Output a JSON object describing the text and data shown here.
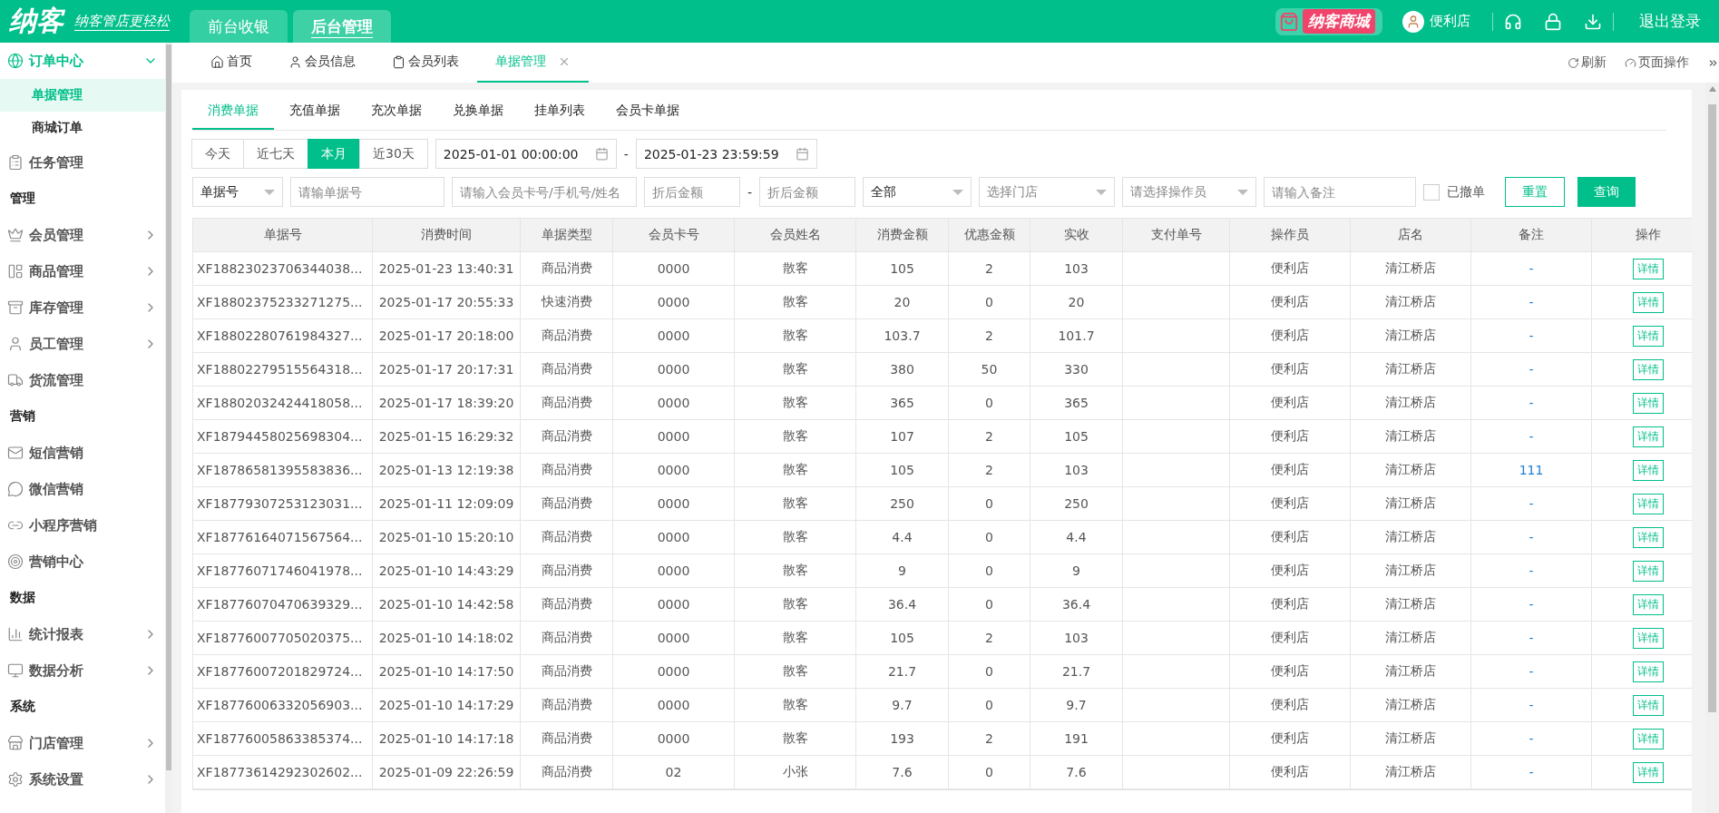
{
  "header": {
    "logo": "纳客",
    "slogan": "纳客管店更轻松",
    "nav": [
      {
        "label": "前台收银",
        "selected": false
      },
      {
        "label": "后台管理",
        "selected": true
      }
    ],
    "mall": "纳客商城",
    "user": "便利店",
    "logout": "退出登录"
  },
  "sidebar": {
    "items": [
      {
        "kind": "menu",
        "label": "订单中心",
        "expanded": true,
        "children": [
          {
            "label": "单据管理",
            "selected": true
          },
          {
            "label": "商城订单",
            "selected": false
          }
        ]
      },
      {
        "kind": "link",
        "label": "任务管理"
      },
      {
        "kind": "section",
        "label": "管理"
      },
      {
        "kind": "menu",
        "label": "会员管理",
        "expanded": false
      },
      {
        "kind": "menu",
        "label": "商品管理",
        "expanded": false
      },
      {
        "kind": "menu",
        "label": "库存管理",
        "expanded": false
      },
      {
        "kind": "menu",
        "label": "员工管理",
        "expanded": false
      },
      {
        "kind": "link",
        "label": "货流管理"
      },
      {
        "kind": "section",
        "label": "营销"
      },
      {
        "kind": "link",
        "label": "短信营销"
      },
      {
        "kind": "link",
        "label": "微信营销"
      },
      {
        "kind": "link",
        "label": "小程序营销"
      },
      {
        "kind": "link",
        "label": "营销中心"
      },
      {
        "kind": "section",
        "label": "数据"
      },
      {
        "kind": "menu",
        "label": "统计报表",
        "expanded": false
      },
      {
        "kind": "menu",
        "label": "数据分析",
        "expanded": false
      },
      {
        "kind": "section",
        "label": "系统"
      },
      {
        "kind": "menu",
        "label": "门店管理",
        "expanded": false
      },
      {
        "kind": "menu",
        "label": "系统设置",
        "expanded": false
      }
    ]
  },
  "page_tabs": [
    {
      "label": "首页",
      "selected": false,
      "closable": false
    },
    {
      "label": "会员信息",
      "selected": false,
      "closable": false
    },
    {
      "label": "会员列表",
      "selected": false,
      "closable": false
    },
    {
      "label": "单据管理",
      "selected": true,
      "closable": true
    }
  ],
  "page_actions": [
    "刷新",
    "页面操作"
  ],
  "sub_tabs": [
    {
      "label": "消费单据",
      "selected": true
    },
    {
      "label": "充值单据",
      "selected": false
    },
    {
      "label": "充次单据",
      "selected": false
    },
    {
      "label": "兑换单据",
      "selected": false
    },
    {
      "label": "挂单列表",
      "selected": false
    },
    {
      "label": "会员卡单据",
      "selected": false
    }
  ],
  "date_ranges": [
    {
      "label": "今天",
      "selected": false
    },
    {
      "label": "近七天",
      "selected": false
    },
    {
      "label": "本月",
      "selected": true
    },
    {
      "label": "近30天",
      "selected": false
    }
  ],
  "date_from": "2025-01-01 00:00:00",
  "date_separator": "-",
  "date_to": "2025-01-23 23:59:59",
  "filters": [
    {
      "kind": "select",
      "value": "单据号"
    },
    {
      "kind": "input",
      "placeholder": "请输单据号"
    },
    {
      "kind": "input",
      "placeholder": "请输入会员卡号/手机号/姓名"
    },
    {
      "kind": "input",
      "placeholder": "折后金额"
    },
    {
      "kind": "dash",
      "text": "-"
    },
    {
      "kind": "input",
      "placeholder": "折后金额"
    },
    {
      "kind": "select",
      "value": "全部"
    },
    {
      "kind": "select",
      "placeholder": "选择门店"
    },
    {
      "kind": "select",
      "placeholder": "请选择操作员"
    },
    {
      "kind": "input",
      "placeholder": "请输入备注"
    }
  ],
  "revoked": {
    "label": "已撤单",
    "checked": false
  },
  "buttons": {
    "reset": "重置",
    "query": "查询"
  },
  "table": {
    "columns": [
      "单据号",
      "消费时间",
      "单据类型",
      "会员卡号",
      "会员姓名",
      "消费金额",
      "优惠金额",
      "实收",
      "支付单号",
      "操作员",
      "店名",
      "备注",
      "操作"
    ],
    "rows": [
      [
        "XF18823023706344038...",
        "2025-01-23 13:40:31",
        "商品消费",
        "0000",
        "散客",
        "105",
        "2",
        "103",
        "",
        "便利店",
        "清江桥店",
        "-",
        "详情"
      ],
      [
        "XF18802375233271275...",
        "2025-01-17 20:55:33",
        "快速消费",
        "0000",
        "散客",
        "20",
        "0",
        "20",
        "",
        "便利店",
        "清江桥店",
        "-",
        "详情"
      ],
      [
        "XF18802280761984327...",
        "2025-01-17 20:18:00",
        "商品消费",
        "0000",
        "散客",
        "103.7",
        "2",
        "101.7",
        "",
        "便利店",
        "清江桥店",
        "-",
        "详情"
      ],
      [
        "XF18802279515564318...",
        "2025-01-17 20:17:31",
        "商品消费",
        "0000",
        "散客",
        "380",
        "50",
        "330",
        "",
        "便利店",
        "清江桥店",
        "-",
        "详情"
      ],
      [
        "XF18802032424418058...",
        "2025-01-17 18:39:20",
        "商品消费",
        "0000",
        "散客",
        "365",
        "0",
        "365",
        "",
        "便利店",
        "清江桥店",
        "-",
        "详情"
      ],
      [
        "XF18794458025698304...",
        "2025-01-15 16:29:32",
        "商品消费",
        "0000",
        "散客",
        "107",
        "2",
        "105",
        "",
        "便利店",
        "清江桥店",
        "-",
        "详情"
      ],
      [
        "XF18786581395583836...",
        "2025-01-13 12:19:38",
        "商品消费",
        "0000",
        "散客",
        "105",
        "2",
        "103",
        "",
        "便利店",
        "清江桥店",
        "111",
        "详情"
      ],
      [
        "XF18779307253123031...",
        "2025-01-11 12:09:09",
        "商品消费",
        "0000",
        "散客",
        "250",
        "0",
        "250",
        "",
        "便利店",
        "清江桥店",
        "-",
        "详情"
      ],
      [
        "XF18776164071567564...",
        "2025-01-10 15:20:10",
        "商品消费",
        "0000",
        "散客",
        "4.4",
        "0",
        "4.4",
        "",
        "便利店",
        "清江桥店",
        "-",
        "详情"
      ],
      [
        "XF18776071746041978...",
        "2025-01-10 14:43:29",
        "商品消费",
        "0000",
        "散客",
        "9",
        "0",
        "9",
        "",
        "便利店",
        "清江桥店",
        "-",
        "详情"
      ],
      [
        "XF18776070470639329...",
        "2025-01-10 14:42:58",
        "商品消费",
        "0000",
        "散客",
        "36.4",
        "0",
        "36.4",
        "",
        "便利店",
        "清江桥店",
        "-",
        "详情"
      ],
      [
        "XF18776007705020375...",
        "2025-01-10 14:18:02",
        "商品消费",
        "0000",
        "散客",
        "105",
        "2",
        "103",
        "",
        "便利店",
        "清江桥店",
        "-",
        "详情"
      ],
      [
        "XF18776007201829724...",
        "2025-01-10 14:17:50",
        "商品消费",
        "0000",
        "散客",
        "21.7",
        "0",
        "21.7",
        "",
        "便利店",
        "清江桥店",
        "-",
        "详情"
      ],
      [
        "XF18776006332056903...",
        "2025-01-10 14:17:29",
        "商品消费",
        "0000",
        "散客",
        "9.7",
        "0",
        "9.7",
        "",
        "便利店",
        "清江桥店",
        "-",
        "详情"
      ],
      [
        "XF18776005863385374...",
        "2025-01-10 14:17:18",
        "商品消费",
        "0000",
        "散客",
        "193",
        "2",
        "191",
        "",
        "便利店",
        "清江桥店",
        "-",
        "详情"
      ],
      [
        "XF18773614292302602...",
        "2025-01-09 22:26:59",
        "商品消费",
        "02",
        "小张",
        "7.6",
        "0",
        "7.6",
        "",
        "便利店",
        "清江桥店",
        "-",
        "详情"
      ]
    ]
  }
}
